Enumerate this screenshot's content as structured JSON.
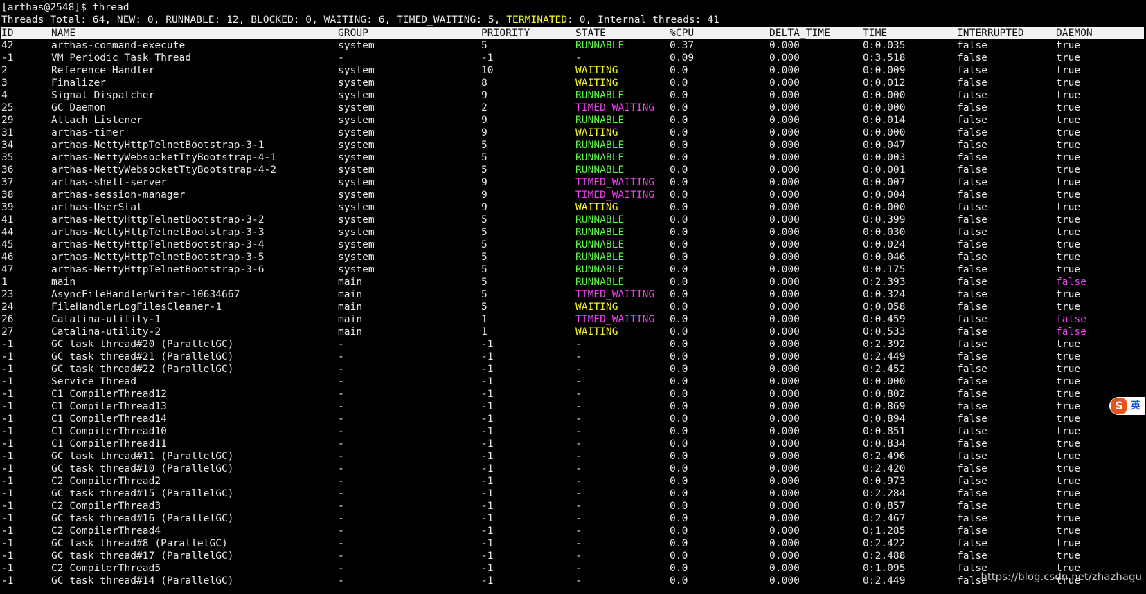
{
  "prompt": {
    "user_host": "[arthas@2548]$",
    "command": " thread"
  },
  "summary": {
    "part1": "Threads Total: 64, NEW: 0, RUNNABLE: 12, BLOCKED: 0, WAITING: 6, TIMED_WAITING: 5, ",
    "terminated_label": "TERMINATED",
    "part2": ": 0, Internal threads: 41"
  },
  "columns": [
    "ID",
    "NAME",
    "GROUP",
    "PRIORITY",
    "STATE",
    "%CPU",
    "DELTA_TIME",
    "TIME",
    "INTERRUPTED",
    "DAEMON"
  ],
  "rows": [
    [
      "42",
      "arthas-command-execute",
      "system",
      "5",
      "RUNNABLE",
      "0.37",
      "0.000",
      "0:0.035",
      "false",
      "true"
    ],
    [
      "-1",
      "VM Periodic Task Thread",
      "-",
      "-1",
      "-",
      "0.09",
      "0.000",
      "0:3.518",
      "false",
      "true"
    ],
    [
      "2",
      "Reference Handler",
      "system",
      "10",
      "WAITING",
      "0.0",
      "0.000",
      "0:0.009",
      "false",
      "true"
    ],
    [
      "3",
      "Finalizer",
      "system",
      "8",
      "WAITING",
      "0.0",
      "0.000",
      "0:0.012",
      "false",
      "true"
    ],
    [
      "4",
      "Signal Dispatcher",
      "system",
      "9",
      "RUNNABLE",
      "0.0",
      "0.000",
      "0:0.000",
      "false",
      "true"
    ],
    [
      "25",
      "GC Daemon",
      "system",
      "2",
      "TIMED_WAITING",
      "0.0",
      "0.000",
      "0:0.000",
      "false",
      "true"
    ],
    [
      "29",
      "Attach Listener",
      "system",
      "9",
      "RUNNABLE",
      "0.0",
      "0.000",
      "0:0.014",
      "false",
      "true"
    ],
    [
      "31",
      "arthas-timer",
      "system",
      "9",
      "WAITING",
      "0.0",
      "0.000",
      "0:0.000",
      "false",
      "true"
    ],
    [
      "34",
      "arthas-NettyHttpTelnetBootstrap-3-1",
      "system",
      "5",
      "RUNNABLE",
      "0.0",
      "0.000",
      "0:0.047",
      "false",
      "true"
    ],
    [
      "35",
      "arthas-NettyWebsocketTtyBootstrap-4-1",
      "system",
      "5",
      "RUNNABLE",
      "0.0",
      "0.000",
      "0:0.003",
      "false",
      "true"
    ],
    [
      "36",
      "arthas-NettyWebsocketTtyBootstrap-4-2",
      "system",
      "5",
      "RUNNABLE",
      "0.0",
      "0.000",
      "0:0.001",
      "false",
      "true"
    ],
    [
      "37",
      "arthas-shell-server",
      "system",
      "9",
      "TIMED_WAITING",
      "0.0",
      "0.000",
      "0:0.007",
      "false",
      "true"
    ],
    [
      "38",
      "arthas-session-manager",
      "system",
      "9",
      "TIMED_WAITING",
      "0.0",
      "0.000",
      "0:0.004",
      "false",
      "true"
    ],
    [
      "39",
      "arthas-UserStat",
      "system",
      "9",
      "WAITING",
      "0.0",
      "0.000",
      "0:0.000",
      "false",
      "true"
    ],
    [
      "41",
      "arthas-NettyHttpTelnetBootstrap-3-2",
      "system",
      "5",
      "RUNNABLE",
      "0.0",
      "0.000",
      "0:0.399",
      "false",
      "true"
    ],
    [
      "44",
      "arthas-NettyHttpTelnetBootstrap-3-3",
      "system",
      "5",
      "RUNNABLE",
      "0.0",
      "0.000",
      "0:0.030",
      "false",
      "true"
    ],
    [
      "45",
      "arthas-NettyHttpTelnetBootstrap-3-4",
      "system",
      "5",
      "RUNNABLE",
      "0.0",
      "0.000",
      "0:0.024",
      "false",
      "true"
    ],
    [
      "46",
      "arthas-NettyHttpTelnetBootstrap-3-5",
      "system",
      "5",
      "RUNNABLE",
      "0.0",
      "0.000",
      "0:0.046",
      "false",
      "true"
    ],
    [
      "47",
      "arthas-NettyHttpTelnetBootstrap-3-6",
      "system",
      "5",
      "RUNNABLE",
      "0.0",
      "0.000",
      "0:0.175",
      "false",
      "true"
    ],
    [
      "1",
      "main",
      "main",
      "5",
      "RUNNABLE",
      "0.0",
      "0.000",
      "0:2.393",
      "false",
      "false"
    ],
    [
      "23",
      "AsyncFileHandlerWriter-10634667",
      "main",
      "5",
      "TIMED_WAITING",
      "0.0",
      "0.000",
      "0:0.324",
      "false",
      "true"
    ],
    [
      "24",
      "FileHandlerLogFilesCleaner-1",
      "main",
      "5",
      "WAITING",
      "0.0",
      "0.000",
      "0:0.058",
      "false",
      "true"
    ],
    [
      "26",
      "Catalina-utility-1",
      "main",
      "1",
      "TIMED_WAITING",
      "0.0",
      "0.000",
      "0:0.459",
      "false",
      "false"
    ],
    [
      "27",
      "Catalina-utility-2",
      "main",
      "1",
      "WAITING",
      "0.0",
      "0.000",
      "0:0.533",
      "false",
      "false"
    ],
    [
      "-1",
      "GC task thread#20 (ParallelGC)",
      "-",
      "-1",
      "-",
      "0.0",
      "0.000",
      "0:2.392",
      "false",
      "true"
    ],
    [
      "-1",
      "GC task thread#21 (ParallelGC)",
      "-",
      "-1",
      "-",
      "0.0",
      "0.000",
      "0:2.449",
      "false",
      "true"
    ],
    [
      "-1",
      "GC task thread#22 (ParallelGC)",
      "-",
      "-1",
      "-",
      "0.0",
      "0.000",
      "0:2.452",
      "false",
      "true"
    ],
    [
      "-1",
      "Service Thread",
      "-",
      "-1",
      "-",
      "0.0",
      "0.000",
      "0:0.000",
      "false",
      "true"
    ],
    [
      "-1",
      "C1 CompilerThread12",
      "-",
      "-1",
      "-",
      "0.0",
      "0.000",
      "0:0.802",
      "false",
      "true"
    ],
    [
      "-1",
      "C1 CompilerThread13",
      "-",
      "-1",
      "-",
      "0.0",
      "0.000",
      "0:0.869",
      "false",
      "true"
    ],
    [
      "-1",
      "C1 CompilerThread14",
      "-",
      "-1",
      "-",
      "0.0",
      "0.000",
      "0:0.894",
      "false",
      "true"
    ],
    [
      "-1",
      "C1 CompilerThread10",
      "-",
      "-1",
      "-",
      "0.0",
      "0.000",
      "0:0.851",
      "false",
      "true"
    ],
    [
      "-1",
      "C1 CompilerThread11",
      "-",
      "-1",
      "-",
      "0.0",
      "0.000",
      "0:0.834",
      "false",
      "true"
    ],
    [
      "-1",
      "GC task thread#11 (ParallelGC)",
      "-",
      "-1",
      "-",
      "0.0",
      "0.000",
      "0:2.496",
      "false",
      "true"
    ],
    [
      "-1",
      "GC task thread#10 (ParallelGC)",
      "-",
      "-1",
      "-",
      "0.0",
      "0.000",
      "0:2.420",
      "false",
      "true"
    ],
    [
      "-1",
      "C2 CompilerThread2",
      "-",
      "-1",
      "-",
      "0.0",
      "0.000",
      "0:0.973",
      "false",
      "true"
    ],
    [
      "-1",
      "GC task thread#15 (ParallelGC)",
      "-",
      "-1",
      "-",
      "0.0",
      "0.000",
      "0:2.284",
      "false",
      "true"
    ],
    [
      "-1",
      "C2 CompilerThread3",
      "-",
      "-1",
      "-",
      "0.0",
      "0.000",
      "0:0.857",
      "false",
      "true"
    ],
    [
      "-1",
      "GC task thread#16 (ParallelGC)",
      "-",
      "-1",
      "-",
      "0.0",
      "0.000",
      "0:2.467",
      "false",
      "true"
    ],
    [
      "-1",
      "C2 CompilerThread4",
      "-",
      "-1",
      "-",
      "0.0",
      "0.000",
      "0:1.285",
      "false",
      "true"
    ],
    [
      "-1",
      "GC task thread#8 (ParallelGC)",
      "-",
      "-1",
      "-",
      "0.0",
      "0.000",
      "0:2.422",
      "false",
      "true"
    ],
    [
      "-1",
      "GC task thread#17 (ParallelGC)",
      "-",
      "-1",
      "-",
      "0.0",
      "0.000",
      "0:2.488",
      "false",
      "true"
    ],
    [
      "-1",
      "C2 CompilerThread5",
      "-",
      "-1",
      "-",
      "0.0",
      "0.000",
      "0:1.095",
      "false",
      "true"
    ],
    [
      "-1",
      "GC task thread#14 (ParallelGC)",
      "-",
      "-1",
      "-",
      "0.0",
      "0.000",
      "0:2.449",
      "false",
      "true"
    ]
  ],
  "colors": {
    "RUNNABLE": "#5cf442",
    "WAITING": "#f4f42c",
    "TIMED_WAITING": "#f040f0",
    "daemon_false": "#f040f0"
  },
  "ime": {
    "logo": "S",
    "lang": "英"
  },
  "watermark": "https://blog.csdn.net/zhazhagu"
}
